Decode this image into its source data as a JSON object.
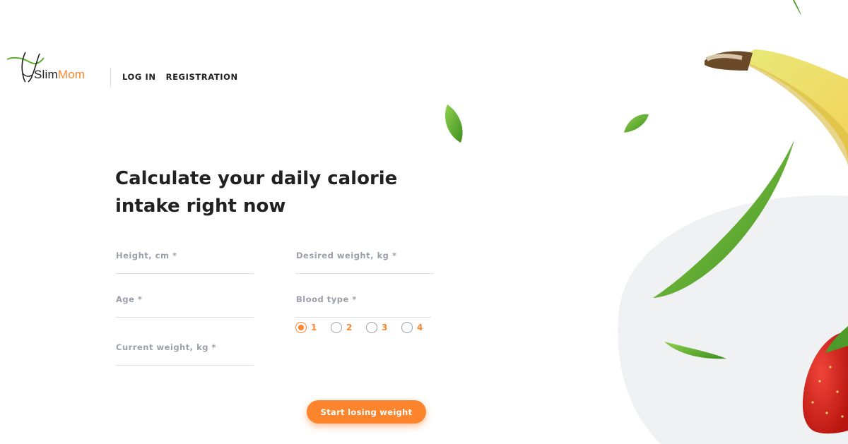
{
  "header": {
    "logo_slim": "Slim",
    "logo_mom": "Mom",
    "nav": [
      {
        "label": "LOG IN"
      },
      {
        "label": "REGISTRATION"
      }
    ]
  },
  "main": {
    "title": "Calculate your daily calorie intake right now",
    "fields": {
      "height": {
        "label": "Height, cm *",
        "value": ""
      },
      "desired_weight": {
        "label": "Desired weight, kg *",
        "value": ""
      },
      "age": {
        "label": "Age *",
        "value": ""
      },
      "blood_type": {
        "label": "Blood type *"
      },
      "current_weight": {
        "label": "Current weight, kg *",
        "value": ""
      }
    },
    "blood_type_options": [
      {
        "label": "1",
        "checked": true
      },
      {
        "label": "2",
        "checked": false
      },
      {
        "label": "3",
        "checked": false
      },
      {
        "label": "4",
        "checked": false
      }
    ],
    "submit_label": "Start losing weight"
  },
  "colors": {
    "accent": "#fc842d",
    "text": "#212121",
    "muted": "#9b9faa",
    "line": "#e0e0e0",
    "blob": "#f0f1f3"
  },
  "decoration": {
    "icons": [
      "logo-leaf-icon",
      "leaf-icon",
      "banana-image",
      "strawberry-image"
    ]
  }
}
